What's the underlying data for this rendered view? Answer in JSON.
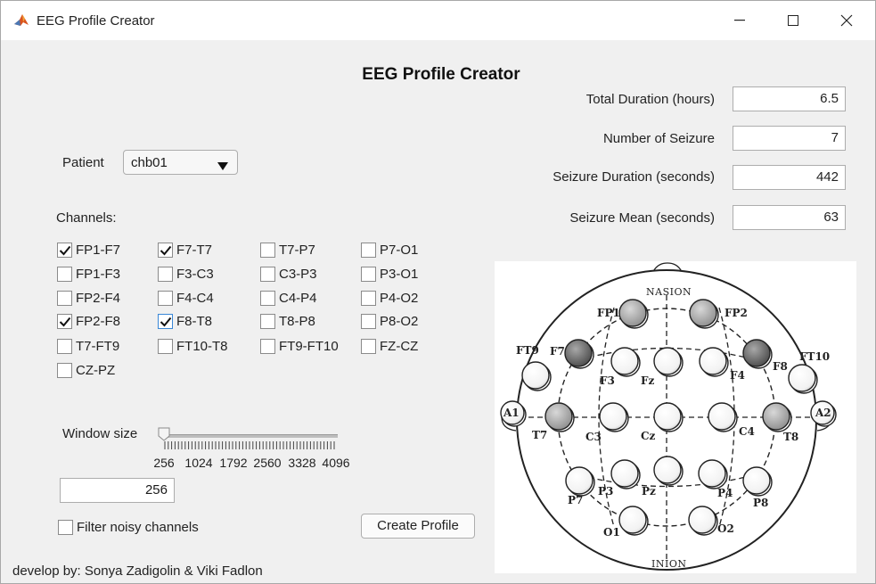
{
  "window": {
    "title": "EEG Profile Creator",
    "controls": [
      "minimize",
      "maximize",
      "close"
    ]
  },
  "main_title": "EEG Profile Creator",
  "patient": {
    "label": "Patient",
    "selected": "chb01"
  },
  "stats": [
    {
      "label": "Total Duration (hours)",
      "value": "6.5"
    },
    {
      "label": "Number of Seizure",
      "value": "7"
    },
    {
      "label": "Seizure Duration (seconds)",
      "value": "442"
    },
    {
      "label": "Seizure Mean (seconds)",
      "value": "63"
    }
  ],
  "channels": {
    "label": "Channels:",
    "items": [
      {
        "label": "FP1-F7",
        "checked": true
      },
      {
        "label": "F7-T7",
        "checked": true
      },
      {
        "label": "T7-P7",
        "checked": false
      },
      {
        "label": "P7-O1",
        "checked": false
      },
      {
        "label": "FP1-F3",
        "checked": false
      },
      {
        "label": "F3-C3",
        "checked": false
      },
      {
        "label": "C3-P3",
        "checked": false
      },
      {
        "label": "P3-O1",
        "checked": false
      },
      {
        "label": "FP2-F4",
        "checked": false
      },
      {
        "label": "F4-C4",
        "checked": false
      },
      {
        "label": "C4-P4",
        "checked": false
      },
      {
        "label": "P4-O2",
        "checked": false
      },
      {
        "label": "FP2-F8",
        "checked": true
      },
      {
        "label": "F8-T8",
        "checked": true
      },
      {
        "label": "T8-P8",
        "checked": false
      },
      {
        "label": "P8-O2",
        "checked": false
      },
      {
        "label": "T7-FT9",
        "checked": false
      },
      {
        "label": "FT10-T8",
        "checked": false
      },
      {
        "label": "FT9-FT10",
        "checked": false
      },
      {
        "label": "FZ-CZ",
        "checked": false
      },
      {
        "label": "CZ-PZ",
        "checked": false
      }
    ]
  },
  "window_size": {
    "label": "Window size",
    "min": 256,
    "max": 4096,
    "value": 256,
    "value_text": "256",
    "tick_labels": [
      "256",
      "1024",
      "1792",
      "2560",
      "3328",
      "4096"
    ]
  },
  "filter": {
    "label": "Filter noisy channels",
    "checked": false
  },
  "create_button": "Create Profile",
  "footer": "develop by: Sonya Zadigolin & Viki Fadlon",
  "diagram": {
    "nasion": "NASION",
    "inion": "INION",
    "electrodes": [
      {
        "name": "FP1",
        "highlight": "light"
      },
      {
        "name": "FP2",
        "highlight": "light"
      },
      {
        "name": "F7",
        "highlight": "dark"
      },
      {
        "name": "F8",
        "highlight": "dark"
      },
      {
        "name": "FT9",
        "highlight": "none"
      },
      {
        "name": "FT10",
        "highlight": "none"
      },
      {
        "name": "F3",
        "highlight": "none"
      },
      {
        "name": "Fz",
        "highlight": "none"
      },
      {
        "name": "F4",
        "highlight": "none"
      },
      {
        "name": "A1",
        "highlight": "none"
      },
      {
        "name": "A2",
        "highlight": "none"
      },
      {
        "name": "T7",
        "highlight": "light"
      },
      {
        "name": "C3",
        "highlight": "none"
      },
      {
        "name": "Cz",
        "highlight": "none"
      },
      {
        "name": "C4",
        "highlight": "none"
      },
      {
        "name": "T8",
        "highlight": "light"
      },
      {
        "name": "P7",
        "highlight": "none"
      },
      {
        "name": "P3",
        "highlight": "none"
      },
      {
        "name": "Pz",
        "highlight": "none"
      },
      {
        "name": "P4",
        "highlight": "none"
      },
      {
        "name": "P8",
        "highlight": "none"
      },
      {
        "name": "O1",
        "highlight": "none"
      },
      {
        "name": "O2",
        "highlight": "none"
      }
    ]
  },
  "colors": {
    "window_bg": "#f0f0f0",
    "check_accent": "#3a87d6"
  }
}
